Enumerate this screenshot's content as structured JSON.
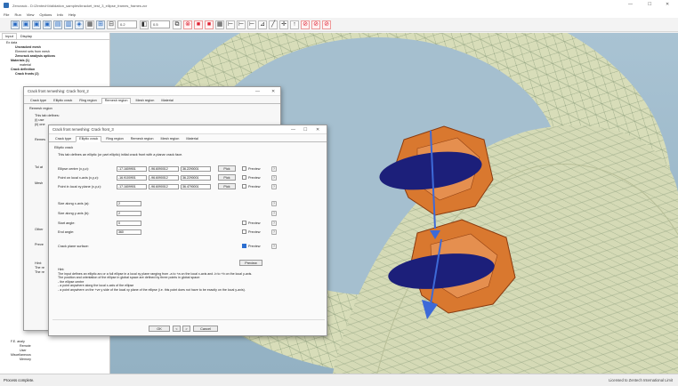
{
  "window": {
    "title": "Zencrack - D:\\Zentech\\Validation_samples\\bracket_test_3_ellipse_frames_frames.zcr",
    "minimize": "—",
    "maximize": "☐",
    "close": "✕"
  },
  "menu": [
    "File",
    "Run",
    "View",
    "Options",
    "Info",
    "Help"
  ],
  "toolbar": {
    "select1": "0.2",
    "select2": "0.5"
  },
  "left_panel": {
    "tabs": [
      "Input",
      "Display"
    ],
    "tree": [
      {
        "label": "Ex data",
        "bold": false,
        "indent": 1
      },
      {
        "label": "Uncracked mesh",
        "bold": true,
        "indent": 3
      },
      {
        "label": "Element sets from mesh",
        "bold": false,
        "indent": 3
      },
      {
        "label": "Zencrack analysis options",
        "bold": true,
        "indent": 3
      },
      {
        "label": "Materials (1)",
        "bold": true,
        "indent": 2
      },
      {
        "label": "material",
        "bold": false,
        "indent": 4
      },
      {
        "label": "Crack definition",
        "bold": true,
        "indent": 2
      },
      {
        "label": "Crack fronts (2)",
        "bold": true,
        "indent": 3
      }
    ],
    "tree_lower": [
      {
        "label": "F.E. analy",
        "indent": 2
      },
      {
        "label": "Remote",
        "indent": 4
      },
      {
        "label": "User",
        "indent": 4
      },
      {
        "label": "Miscellaneous",
        "indent": 2
      },
      {
        "label": "Memory",
        "indent": 4
      }
    ]
  },
  "dialog_back": {
    "title": "Crack front remeshing: Crack front_2",
    "tabs": [
      "Crack type",
      "Elliptic crack",
      "Ring region",
      "Remesh region",
      "Mesh region",
      "Material"
    ],
    "active_tab": 3,
    "group": "Remesh region",
    "text_lines": [
      "This tab defines:",
      "(i) use",
      "(ii) one"
    ],
    "side_labels": [
      "Remes",
      "Tol at",
      "Mesh",
      "Other",
      "Preve",
      "Hint:",
      "The re",
      "The re"
    ]
  },
  "dialog": {
    "title": "Crack front remeshing: Crack front_3",
    "tabs": [
      "Crack type",
      "Elliptic crack",
      "Ring region",
      "Remesh region",
      "Mesh region",
      "Material"
    ],
    "active_tab": 1,
    "group_title": "Elliptic crack",
    "description": "This tab defines an elliptic (or part elliptic) initial crack front with a planar crack face.",
    "coord_rows": [
      {
        "label": "Ellipse centre (x,y,z):",
        "values": [
          "-17.1609901",
          "-96.6090012",
          "36.2290001"
        ],
        "pick": "Pick",
        "preview": "Preview",
        "help": "?"
      },
      {
        "label": "Point on local x-axis (x,y,z):",
        "values": [
          "-16.9100901",
          "-96.6090012",
          "36.2290001"
        ],
        "pick": "Pick",
        "preview": "Preview",
        "help": "?"
      },
      {
        "label": "Point in local xy plane (x,y,z):",
        "values": [
          "-17.1609901",
          "-96.6090012",
          "36.4790001"
        ],
        "pick": "Pick",
        "preview": "Preview",
        "help": "?"
      }
    ],
    "param_rows": [
      {
        "label": "Size along x-axis (a):",
        "value": "2",
        "preview": "",
        "help": "?"
      },
      {
        "label": "Size along y-axis (b):",
        "value": "2",
        "preview": "",
        "help": "?"
      },
      {
        "label": "Start angle:",
        "value": "0",
        "preview": "Preview",
        "help": "?"
      },
      {
        "label": "End angle:",
        "value": "360",
        "preview": "Preview",
        "help": "?"
      }
    ],
    "crack_plane": {
      "label": "Crack plane surface:",
      "preview": "Preview",
      "help": "?"
    },
    "preview_button": "Preview",
    "hints": [
      "Hint:",
      "The input defines an elliptic arc or a full ellipse in a local xy plane ranging from -a to +a on the local x-axis and -b to +b on the local y-axis.",
      "The position and orientation of the ellipse in global space are defined by three points in global space:",
      "- the ellipse centre",
      "- a point anywhere along the local x-axis of the ellipse",
      "- a point anywhere on the +ve y side of the local xy plane of the ellipse (i.e. this point does not have to be exactly on the local y-axis)."
    ],
    "footer": {
      "ok": "OK",
      "prev": "<",
      "next": ">",
      "cancel": "Cancel"
    }
  },
  "status": {
    "left": "Process complete.",
    "right": "Licensed to Zentech International Limit"
  }
}
